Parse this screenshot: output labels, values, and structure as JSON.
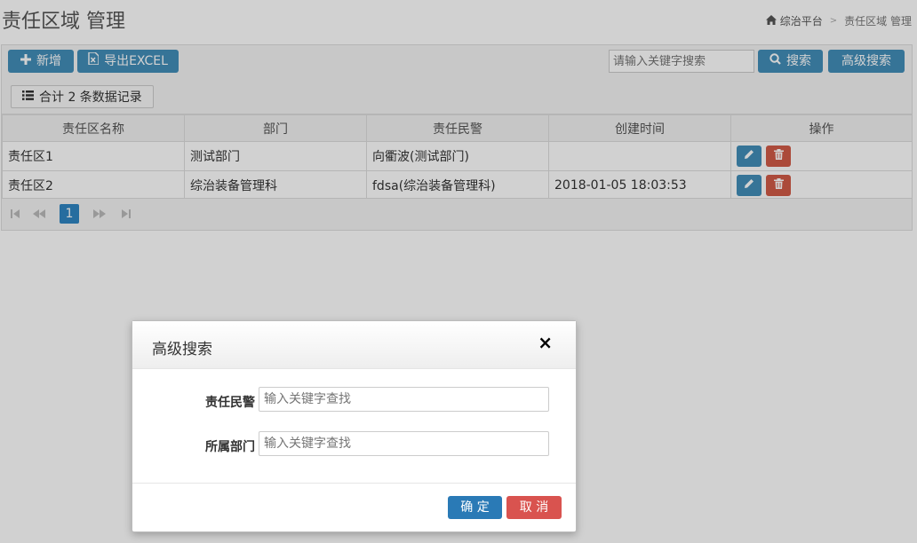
{
  "header": {
    "title": "责任区域 管理",
    "breadcrumb": {
      "home": "综治平台",
      "current": "责任区域 管理"
    }
  },
  "toolbar": {
    "add_label": "新增",
    "export_label": "导出EXCEL",
    "search_placeholder": "请输入关键字搜索",
    "search_label": "搜索",
    "advanced_label": "高级搜索"
  },
  "summary": {
    "count_label": "合计 2 条数据记录"
  },
  "table": {
    "headers": [
      "责任区名称",
      "部门",
      "责任民警",
      "创建时间",
      "操作"
    ],
    "rows": [
      [
        "责任区1",
        "测试部门",
        "向衢波(测试部门)",
        ""
      ],
      [
        "责任区2",
        "综治装备管理科",
        "fdsa(综治装备管理科)",
        "2018-01-05 18:03:53"
      ]
    ]
  },
  "pagination": {
    "current_page": "1"
  },
  "modal": {
    "title": "高级搜索",
    "close_glyph": "×",
    "fields": [
      {
        "label": "责任民警",
        "placeholder": "输入关键字查找"
      },
      {
        "label": "所属部门",
        "placeholder": "输入关键字查找"
      }
    ],
    "confirm_label": "确 定",
    "cancel_label": "取 消"
  },
  "colors": {
    "primary": "#438eb9",
    "danger": "#d15b47",
    "active_page": "#2f86c2"
  },
  "icons": [
    "home-icon",
    "plus-icon",
    "excel-icon",
    "search-icon",
    "list-icon",
    "pencil-icon",
    "trash-icon",
    "first-page-icon",
    "prev-page-icon",
    "next-page-icon",
    "last-page-icon",
    "close-icon"
  ]
}
